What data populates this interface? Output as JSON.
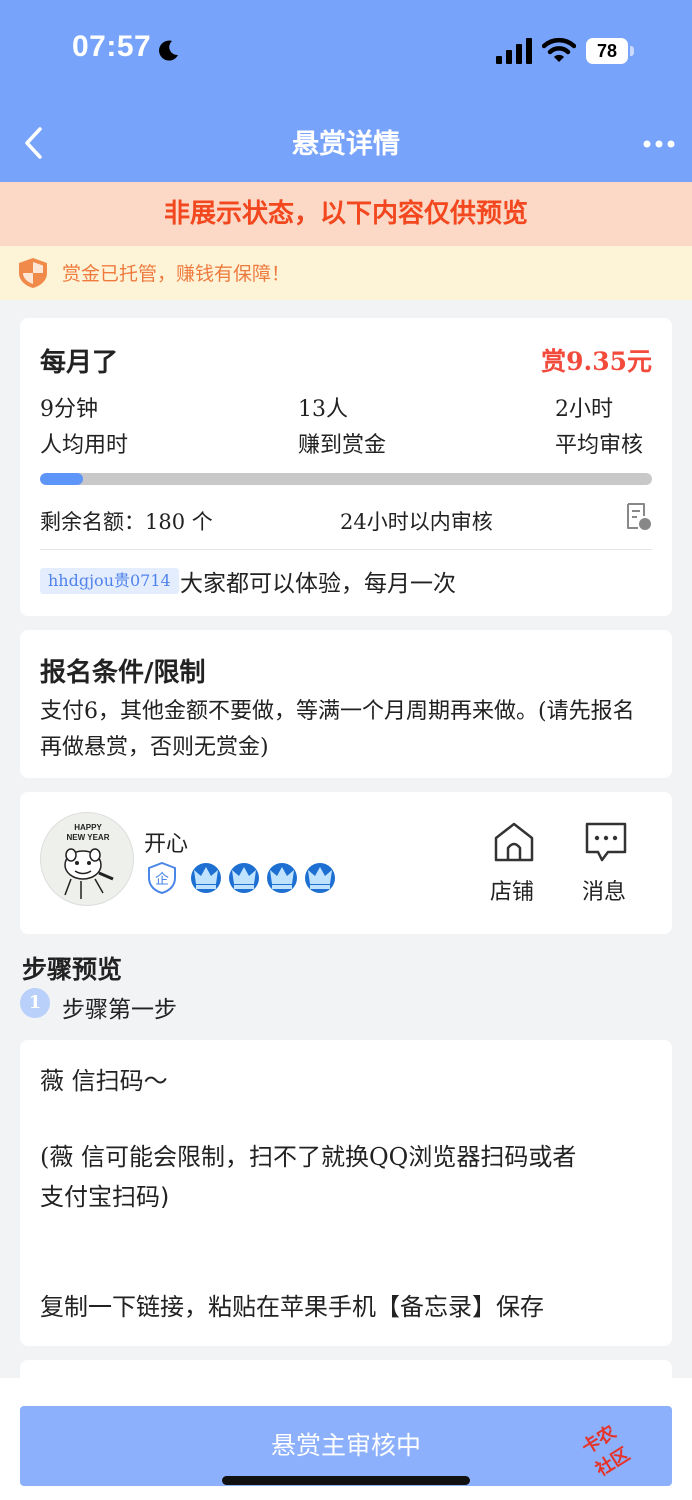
{
  "status_bar": {
    "time": "07:57",
    "battery": "78"
  },
  "nav": {
    "title": "悬赏详情"
  },
  "preview_banner": "非展示状态，以下内容仅供预览",
  "escrow": {
    "text": "赏金已托管，赚钱有保障！"
  },
  "task": {
    "title": "每月了",
    "reward": "赏9.35元",
    "stats": [
      {
        "value": "9分钟",
        "label": "人均用时"
      },
      {
        "value": "13人",
        "label": "赚到赏金"
      },
      {
        "value": "2小时",
        "label": "平均审核"
      }
    ],
    "progress": 0.07,
    "quota": "剩余名额：180 个",
    "review_time": "24小时以内审核",
    "tag": "hhdgjou贵0714",
    "description": "大家都可以体验，每月一次"
  },
  "requirements": {
    "title": "报名条件/限制",
    "body": "支付6，其他金额不要做，等满一个月周期再来做。(请先报名再做悬赏，否则无赏金)"
  },
  "publisher": {
    "name": "开心",
    "avatar_text": [
      "HAPPY",
      "NEW YEAR"
    ],
    "shop_label": "店铺",
    "message_label": "消息",
    "badge_text": "企"
  },
  "steps": {
    "heading": "步骤预览",
    "step_number": "1",
    "step_label": "步骤第一步",
    "lines": [
      "薇 信扫码～",
      "(薇 信可能会限制，扫不了就换QQ浏览器扫码或者",
      "支付宝扫码)",
      "复制一下链接，粘贴在苹果手机【备忘录】保存"
    ]
  },
  "footer": {
    "button": "悬赏主审核中"
  },
  "watermark": {
    "line1": "卡农",
    "line2": "社区"
  }
}
